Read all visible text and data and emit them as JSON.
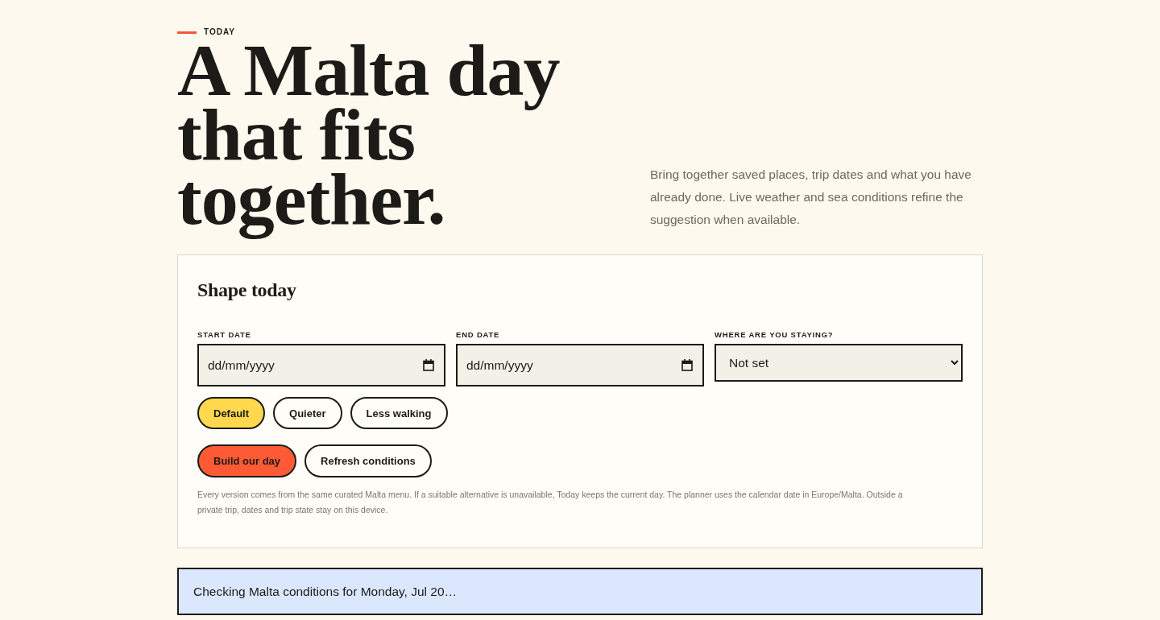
{
  "header": {
    "eyebrow": "TODAY",
    "title": "A Malta day that fits together.",
    "intro": "Bring together saved places, trip dates and what you have already done. Live weather and sea conditions refine the suggestion when available."
  },
  "planner": {
    "title": "Shape today",
    "fields": [
      {
        "kind": "date",
        "label": "START DATE",
        "placeholder": "dd/mm/yyyy"
      },
      {
        "kind": "date",
        "label": "END DATE",
        "placeholder": "dd/mm/yyyy"
      },
      {
        "kind": "select",
        "label": "WHERE ARE YOU STAYING?",
        "value": "Not set"
      }
    ],
    "modes": [
      {
        "label": "Default",
        "selected": true
      },
      {
        "label": "Quieter",
        "selected": false
      },
      {
        "label": "Less walking",
        "selected": false
      }
    ],
    "actions": [
      {
        "label": "Build our day",
        "kind": "primary"
      },
      {
        "label": "Refresh conditions",
        "kind": "secondary"
      }
    ],
    "note": "Every version comes from the same curated Malta menu. If a suitable alternative is unavailable, Today keeps the current day. The planner uses the calendar date in Europe/Malta. Outside a private trip, dates and trip state stay on this device."
  },
  "status": {
    "text": "Checking Malta conditions for Monday, Jul 20…"
  }
}
